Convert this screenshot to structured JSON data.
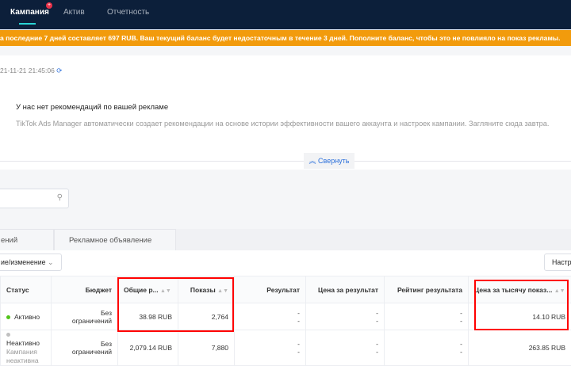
{
  "nav": {
    "tabs": [
      "Кампания",
      "Актив",
      "Отчетность"
    ],
    "badge": "+"
  },
  "warning": "а последние 7 дней составляет 697 RUB. Ваш текущий баланс будет недостаточным в течение 3 дней. Пополните баланс, чтобы это не повлияло на показ рекламы.",
  "timestamp": "21-11-21 21:45:06",
  "recommendations": {
    "title": "У нас нет рекомендаций по вашей рекламе",
    "text": "TikTok Ads Manager автоматически создает рекомендации на основе истории эффективности вашего аккаунта и настроек кампании. Загляните сюда завтра.",
    "collapse": "Свернуть"
  },
  "tabs": [
    "ений",
    "Рекламное объявление"
  ],
  "toolbar": {
    "dropdown": "ие/изменение",
    "settings": "Настр"
  },
  "table": {
    "headers": [
      "Статус",
      "Бюджет",
      "Общие р...",
      "Показы",
      "Результат",
      "Цена за результат",
      "Рейтинг результата",
      "Цена за тысячу показ..."
    ],
    "rows": [
      {
        "status": "Активно",
        "status_color": "#52c41a",
        "sub": "",
        "budget1": "Без",
        "budget2": "ограничений",
        "total": "38.98 RUB",
        "shows": "2,764",
        "result": "-",
        "price": "-",
        "rating": "-",
        "cpm": "14.10 RUB"
      },
      {
        "status": "Неактивно",
        "status_color": "#c0c0c0",
        "sub": "Кампания неактивна",
        "budget1": "Без",
        "budget2": "ограничений",
        "total": "2,079.14 RUB",
        "shows": "7,880",
        "result": "-",
        "price": "-",
        "rating": "-",
        "cpm": "263.85 RUB"
      }
    ]
  }
}
